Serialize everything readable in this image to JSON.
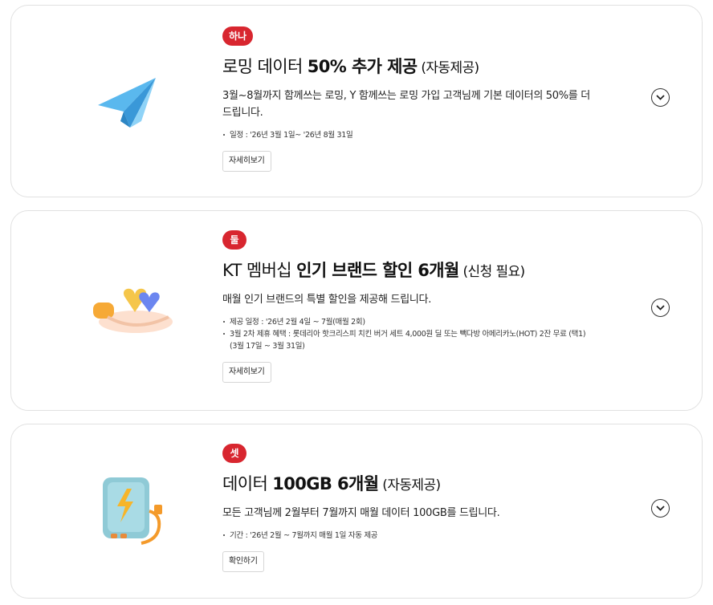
{
  "benefits": [
    {
      "badge": "하나",
      "title_pre": "로밍 데이터 ",
      "title_highlight": "50% 추가 제공",
      "title_suffix": " (자동제공)",
      "description": "3월~8월까지 함께쓰는 로밍, Y 함께쓰는 로밍 가입 고객님께 기본 데이터의 50%를 더 드립니다.",
      "bullets": [
        "일정 : '26년 3월 1일~ '26년 8월 31일"
      ],
      "button_label": "자세히보기",
      "illustration_icon": "paper-plane-icon"
    },
    {
      "badge": "둘",
      "title_pre": "KT 멤버십 ",
      "title_highlight": "인기 브랜드 할인 6개월",
      "title_suffix": " (신청 필요)",
      "description": "매월 인기 브랜드의 특별 할인을 제공해 드립니다.",
      "bullets": [
        "제공 일정 : '26년 2월 4일 ~ 7월(매월 2회)",
        "3월 2차 제휴 혜택 : 롯데리아 핫크리스피 치킨 버거 세트 4,000원 딜 또는 빽다방 아메리카노(HOT) 2잔 무료 (택1)"
      ],
      "bullet_continuation": "(3월 17일 ~ 3월 31일)",
      "button_label": "자세히보기",
      "illustration_icon": "hand-hearts-icon"
    },
    {
      "badge": "셋",
      "title_pre": "데이터 ",
      "title_highlight": "100GB 6개월",
      "title_suffix": " (자동제공)",
      "description": "모든 고객님께 2월부터 7월까지 매월 데이터 100GB를 드립니다.",
      "bullets": [
        "기간 : '26년 2월 ~ 7월까지 매월 1일 자동 제공"
      ],
      "button_label": "확인하기",
      "illustration_icon": "battery-charger-icon"
    }
  ],
  "colors": {
    "badge": "#d8262f",
    "border": "#e1e1e1"
  }
}
